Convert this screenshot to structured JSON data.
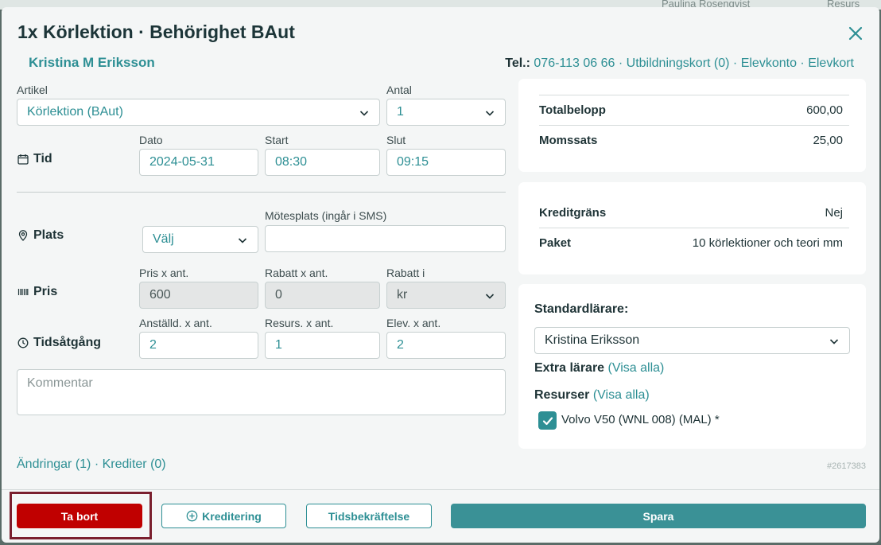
{
  "background": {
    "user_name": "Paulina Rosenqvist",
    "resources_label": "Resurs"
  },
  "modal": {
    "title": "1x Körlektion · Behörighet BAut",
    "student_name": "Kristina M Eriksson",
    "contact": {
      "tel_label": "Tel.:",
      "phone": "076-113 06 66",
      "education_card": "Utbildningskort (0)",
      "account": "Elevkonto",
      "student_card": "Elevkort",
      "separator": "·"
    }
  },
  "form": {
    "article_label": "Artikel",
    "article_value": "Körlektion (BAut)",
    "quantity_label": "Antal",
    "quantity_value": "1",
    "time_row_label": "Tid",
    "date_label": "Dato",
    "date_value": "2024-05-31",
    "start_label": "Start",
    "start_value": "08:30",
    "end_label": "Slut",
    "end_value": "09:15",
    "place_row_label": "Plats",
    "place_select": "Välj",
    "meeting_place_label": "Mötesplats (ingår i SMS)",
    "meeting_place_value": "",
    "price_row_label": "Pris",
    "price_label": "Pris x ant.",
    "price_value": "600",
    "discount_label": "Rabatt x ant.",
    "discount_value": "0",
    "discount_unit_label": "Rabatt i",
    "discount_unit_value": "kr",
    "time_usage_row_label": "Tidsåtgång",
    "employee_label": "Anställd. x ant.",
    "employee_value": "2",
    "resource_label": "Resurs. x ant.",
    "resource_value": "1",
    "student_label": "Elev. x ant.",
    "student_value": "2",
    "comment_placeholder": "Kommentar"
  },
  "summary": {
    "total_label": "Totalbelopp",
    "total_value": "600,00",
    "vat_label": "Momssats",
    "vat_value": "25,00",
    "credit_limit_label": "Kreditgräns",
    "credit_limit_value": "Nej",
    "package_label": "Paket",
    "package_value": "10 körlektioner och teori mm"
  },
  "teachers": {
    "standard_label": "Standardlärare:",
    "standard_value": "Kristina Eriksson",
    "extra_label": "Extra lärare",
    "extra_link": "(Visa alla)",
    "resources_label": "Resurser",
    "resources_link": "(Visa alla)",
    "resource_item": "Volvo V50 (WNL 008) (MAL) *",
    "resource_checked": true
  },
  "footer": {
    "changes": "Ändringar (1)",
    "credits": "Krediter (0)",
    "separator": "·",
    "reference": "#2617383",
    "delete_button": "Ta bort",
    "credit_button": "Kreditering",
    "time_confirm_button": "Tidsbekräftelse",
    "save_button": "Spara"
  },
  "colors": {
    "accent": "#2d8f94",
    "danger": "#c00000",
    "primary_button": "#3a9196",
    "highlight_border": "#7a1f2e"
  }
}
